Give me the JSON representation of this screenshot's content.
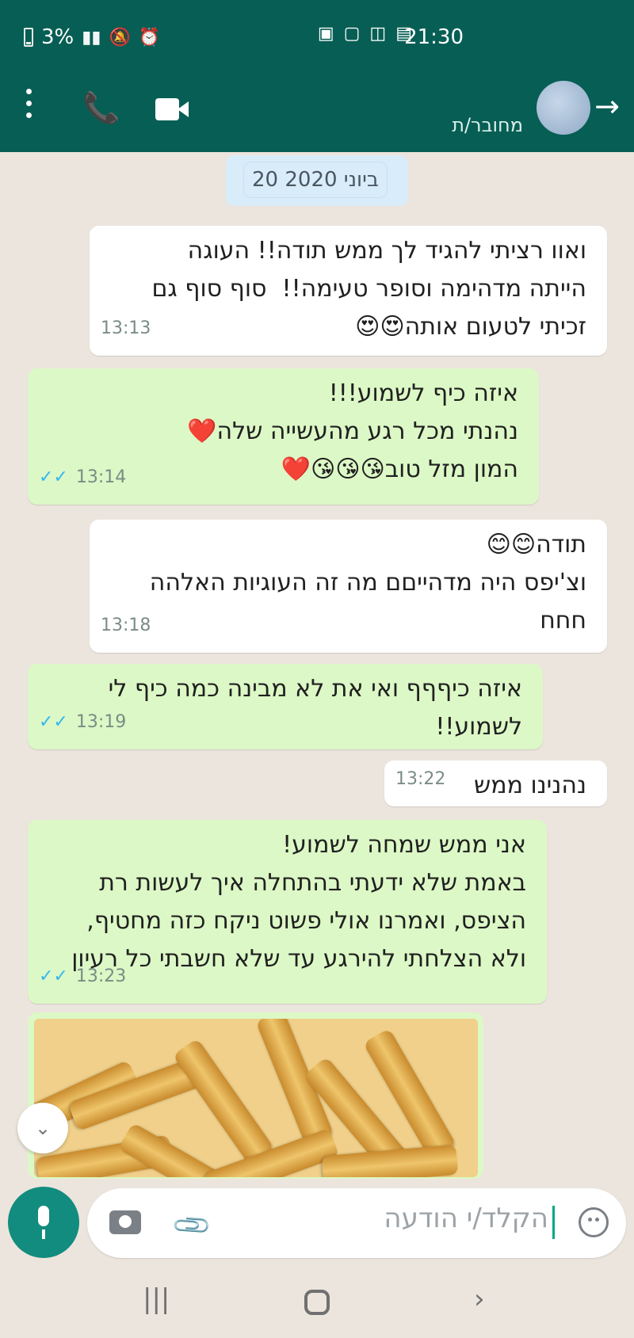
{
  "status_bar": {
    "battery": "3%",
    "time": "21:30"
  },
  "header": {
    "contact_status": "מחובר/ת"
  },
  "date_chip": "20 ביוני 2020",
  "messages": [
    {
      "type": "incoming",
      "text": "ואוו רציתי להגיד לך ממש תודה!! העוגה\nהייתה מדהימה וסופר טעימה!!  סוף סוף גם\nזכיתי לטעום אותה😍😍",
      "time": "13:13"
    },
    {
      "type": "outgoing",
      "text": "איזה כיף לשמוע!!!\nנהנתי מכל רגע מהעשייה שלה❤️\nהמון מזל טוב😘😘😘❤️",
      "time": "13:14"
    },
    {
      "type": "incoming",
      "text": "תודה😊😊\nוצ'יפס היה מדהייםם מה זה העוגיות האלהה\nחחח",
      "time": "13:18"
    },
    {
      "type": "outgoing",
      "text": "איזה כיףףף ואי את לא מבינה כמה כיף לי\nלשמוע!!",
      "time": "13:19"
    },
    {
      "type": "incoming",
      "text": "נהנינו ממש",
      "time": "13:22"
    },
    {
      "type": "outgoing",
      "text": "אני ממש שמחה לשמוע!\nבאמת שלא ידעתי בהתחלה איך לעשות רת\nהציפס, ואמרנו אולי פשוט ניקח כזה מחטיף,\nולא הצלחתי להירגע עד שלא חשבתי כל רעיון",
      "time": "13:23"
    }
  ],
  "composer": {
    "placeholder": "הקלד/י הודעה"
  },
  "icons": {
    "menu": "more-vert-icon",
    "call": "phone-icon",
    "video": "video-camera-icon",
    "back": "arrow-right-icon",
    "emoji": "emoji-icon",
    "attach": "paperclip-icon",
    "camera": "camera-icon",
    "mic": "microphone-icon",
    "scroll_down": "double-chevron-down-icon"
  },
  "colors": {
    "header": "#075e54",
    "incoming_bubble": "#ffffff",
    "outgoing_bubble": "#dcf8c6",
    "accent": "#128c7e"
  }
}
